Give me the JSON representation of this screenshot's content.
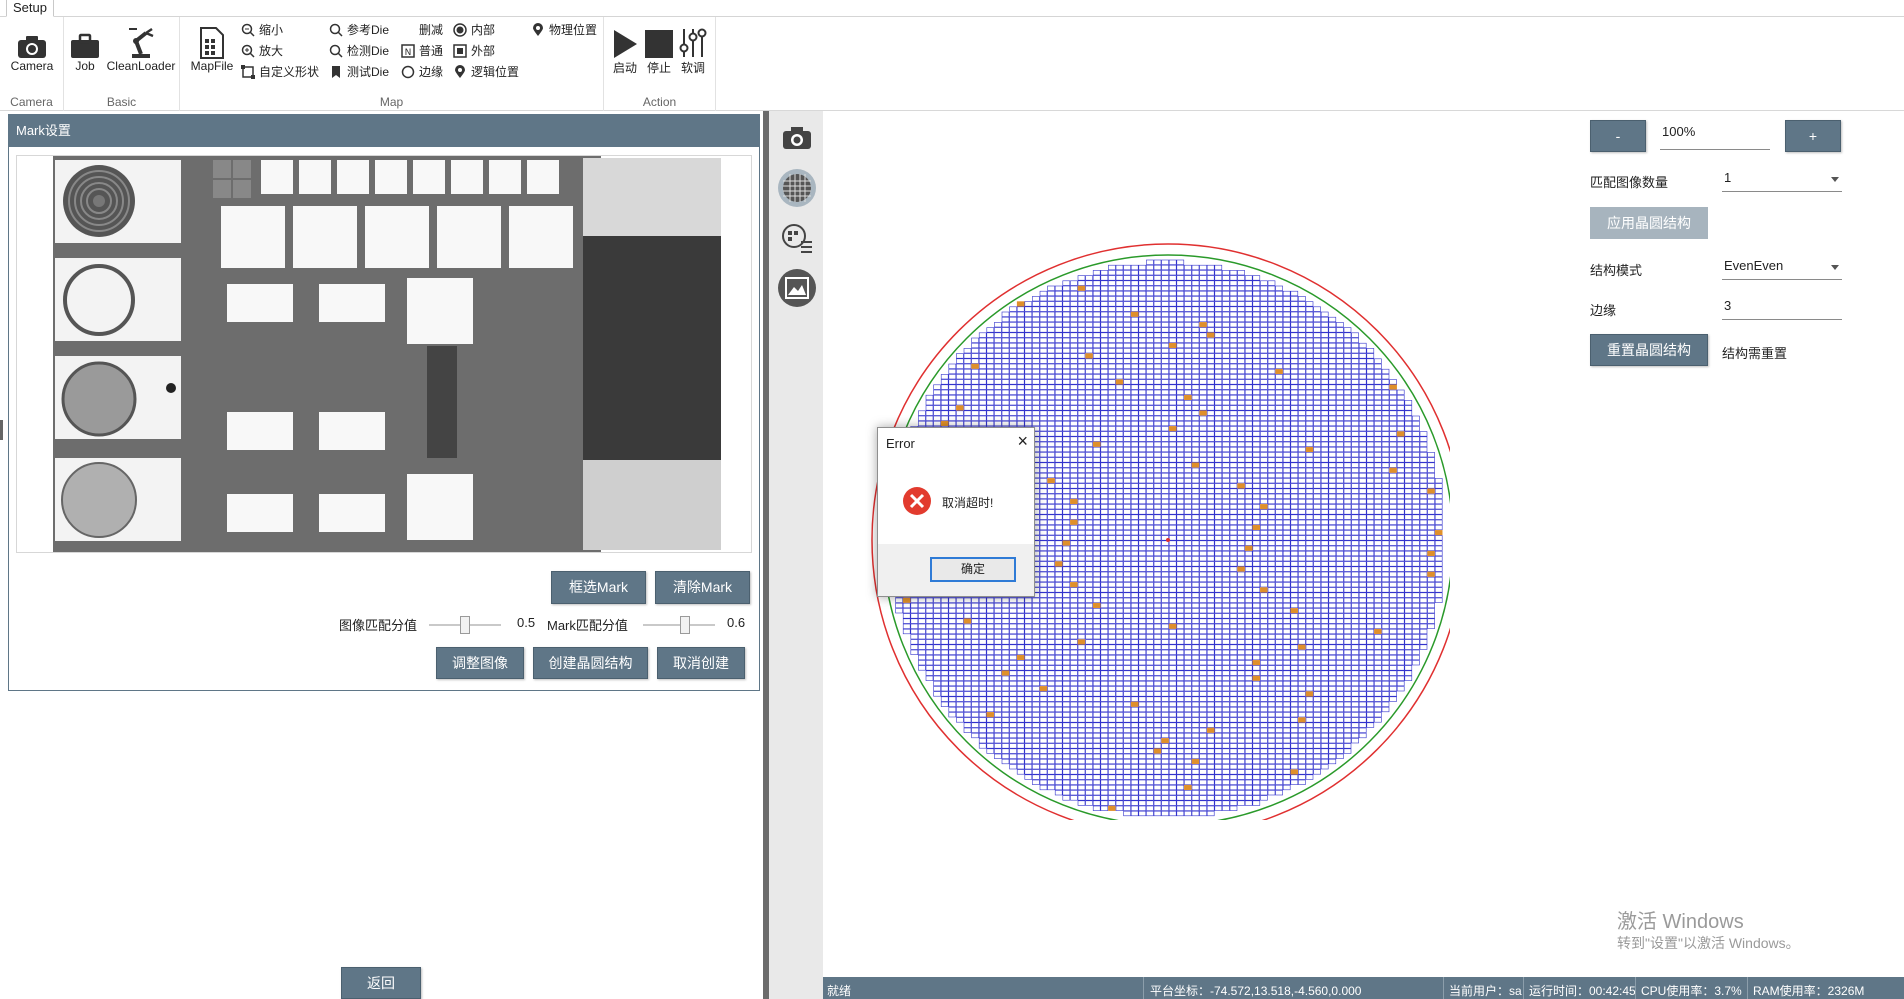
{
  "tabs": [
    "Setup"
  ],
  "ribbon": {
    "groups": {
      "camera": "Camera",
      "basic": "Basic",
      "map": "Map",
      "action": "Action"
    },
    "camera_btn": "Camera",
    "job_btn": "Job",
    "cleanloader_btn": "CleanLoader",
    "mapfile_btn": "MapFile",
    "zoom_out": "缩小",
    "zoom_in": "放大",
    "custom_shape": "自定义形状",
    "ref_die": "参考Die",
    "detect_die": "检测Die",
    "test_die": "测试Die",
    "delete": "删减",
    "normal": "普通",
    "edge": "边缘",
    "inner": "内部",
    "outer": "外部",
    "logic_pos": "逻辑位置",
    "physical_pos": "物理位置",
    "start_btn": "启动",
    "stop_btn": "停止",
    "soft_btn": "软调"
  },
  "mark_panel": {
    "title": "Mark设置",
    "select_mark": "框选Mark",
    "clear_mark": "清除Mark",
    "image_score_label": "图像匹配分值",
    "image_score_value": "0.5",
    "image_score": 0.5,
    "mark_score_label": "Mark匹配分值",
    "mark_score_value": "0.6",
    "mark_score": 0.6,
    "adjust_image": "调整图像",
    "create_wafer": "创建晶圆结构",
    "cancel_create": "取消创建"
  },
  "back_button": "返回",
  "settings": {
    "minus": "-",
    "plus": "+",
    "zoom": "100%",
    "match_count_label": "匹配图像数量",
    "match_count": "1",
    "apply_wafer": "应用晶圆结构",
    "struct_mode_label": "结构模式",
    "struct_mode": "EvenEven",
    "edge_label": "边缘",
    "edge_value": "3",
    "reset_wafer": "重置晶圆结构",
    "reset_hint": "结构需重置"
  },
  "dialog": {
    "title": "Error",
    "message": "取消超时!",
    "ok": "确定"
  },
  "status": {
    "ready": "就绪",
    "platform_coords": "平台坐标：-74.572,13.518,-4.560,0.000",
    "current_user": "当前用户：sa",
    "run_time": "运行时间：00:42:45",
    "cpu": "CPU使用率：3.7%",
    "ram": "RAM使用率：2326M"
  },
  "watermark": {
    "line1": "激活 Windows",
    "line2": "转到\"设置\"以激活 Windows。"
  },
  "colors": {
    "accent": "#5f7687",
    "die_fill": "#ffffff",
    "die_border": "#3333cc",
    "ref_die": "#e0902a",
    "outer_ring": "#e03030",
    "inner_ring": "#2a9a2a"
  }
}
